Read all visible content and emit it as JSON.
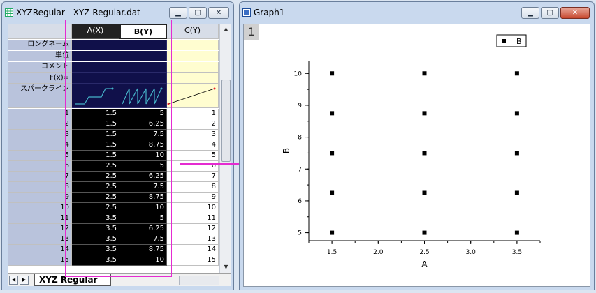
{
  "workbook": {
    "title": "XYZRegular - XYZ Regular.dat",
    "columns": [
      {
        "label": "A(X)"
      },
      {
        "label": "B(Y)"
      },
      {
        "label": "C(Y)"
      }
    ],
    "meta_rows": [
      {
        "label": "ロングネーム"
      },
      {
        "label": "単位"
      },
      {
        "label": "コメント"
      },
      {
        "label": "F(x)="
      },
      {
        "label": "スパークライン"
      }
    ],
    "data_rows": [
      {
        "n": "1",
        "a": "1.5",
        "b": "5",
        "c": "1"
      },
      {
        "n": "2",
        "a": "1.5",
        "b": "6.25",
        "c": "2"
      },
      {
        "n": "3",
        "a": "1.5",
        "b": "7.5",
        "c": "3"
      },
      {
        "n": "4",
        "a": "1.5",
        "b": "8.75",
        "c": "4"
      },
      {
        "n": "5",
        "a": "1.5",
        "b": "10",
        "c": "5"
      },
      {
        "n": "6",
        "a": "2.5",
        "b": "5",
        "c": "6"
      },
      {
        "n": "7",
        "a": "2.5",
        "b": "6.25",
        "c": "7"
      },
      {
        "n": "8",
        "a": "2.5",
        "b": "7.5",
        "c": "8"
      },
      {
        "n": "9",
        "a": "2.5",
        "b": "8.75",
        "c": "9"
      },
      {
        "n": "10",
        "a": "2.5",
        "b": "10",
        "c": "10"
      },
      {
        "n": "11",
        "a": "3.5",
        "b": "5",
        "c": "11"
      },
      {
        "n": "12",
        "a": "3.5",
        "b": "6.25",
        "c": "12"
      },
      {
        "n": "13",
        "a": "3.5",
        "b": "7.5",
        "c": "13"
      },
      {
        "n": "14",
        "a": "3.5",
        "b": "8.75",
        "c": "14"
      },
      {
        "n": "15",
        "a": "3.5",
        "b": "10",
        "c": "15"
      }
    ],
    "sheet_tab": "XYZ Regular",
    "sparkline_colors": {
      "line": "#45b3c9",
      "dot": "#e8262d"
    }
  },
  "graph": {
    "title": "Graph1",
    "layer_label": "1",
    "legend_label": "B",
    "accent": "#e52bd1"
  },
  "chart_data": {
    "type": "scatter",
    "xlabel": "A",
    "ylabel": "B",
    "xlim": [
      1.25,
      3.75
    ],
    "ylim": [
      4.75,
      10.4
    ],
    "xticks": [
      "1.5",
      "2.0",
      "2.5",
      "3.0",
      "3.5"
    ],
    "yticks": [
      "5",
      "6",
      "7",
      "8",
      "9",
      "10"
    ],
    "series": [
      {
        "name": "B",
        "x": [
          1.5,
          1.5,
          1.5,
          1.5,
          1.5,
          2.5,
          2.5,
          2.5,
          2.5,
          2.5,
          3.5,
          3.5,
          3.5,
          3.5,
          3.5
        ],
        "y": [
          5,
          6.25,
          7.5,
          8.75,
          10,
          5,
          6.25,
          7.5,
          8.75,
          10,
          5,
          6.25,
          7.5,
          8.75,
          10
        ]
      }
    ]
  }
}
